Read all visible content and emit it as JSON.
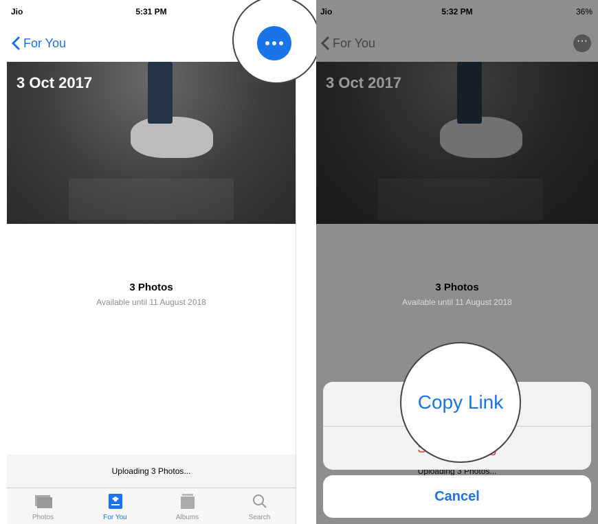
{
  "left": {
    "status": {
      "carrier": "Jio",
      "time": "5:31 PM"
    },
    "nav": {
      "back_label": "For You"
    },
    "hero": {
      "date": "3 Oct 2017"
    },
    "memory": {
      "count": "3 Photos",
      "availability": "Available until 11 August 2018"
    },
    "upload": {
      "text": "Uploading 3 Photos..."
    },
    "tabs": [
      {
        "label": "Photos",
        "icon": "photos-icon"
      },
      {
        "label": "For You",
        "icon": "for-you-icon"
      },
      {
        "label": "Albums",
        "icon": "albums-icon"
      },
      {
        "label": "Search",
        "icon": "search-icon"
      }
    ]
  },
  "right": {
    "status": {
      "carrier": "Jio",
      "time": "5:32 PM",
      "battery": "36%"
    },
    "nav": {
      "back_label": "For You"
    },
    "hero": {
      "date": "3 Oct 2017"
    },
    "memory": {
      "count": "3 Photos",
      "availability": "Available until 11 August 2018"
    },
    "sheet": {
      "copy_link": "Copy Link",
      "stop_sharing": "Stop Sharing",
      "cancel": "Cancel"
    },
    "upload": {
      "text": "Uploading 3 Photos..."
    }
  },
  "colors": {
    "accent": "#1a73e8",
    "destructive": "#e53935"
  }
}
